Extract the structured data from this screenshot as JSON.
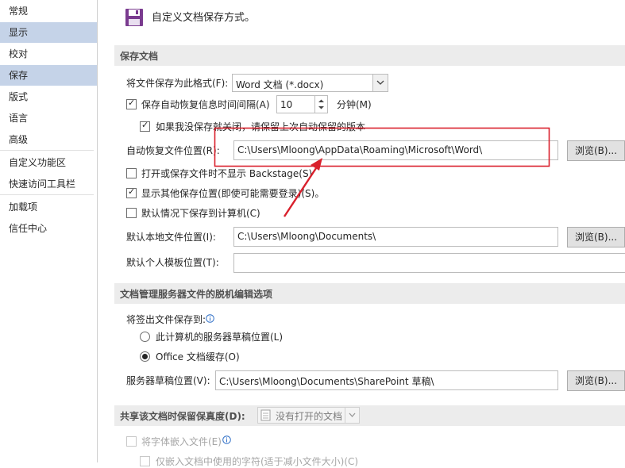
{
  "sidebar": {
    "items": [
      {
        "label": "常规"
      },
      {
        "label": "显示"
      },
      {
        "label": "校对"
      },
      {
        "label": "保存"
      },
      {
        "label": "版式"
      },
      {
        "label": "语言"
      },
      {
        "label": "高级"
      },
      {
        "label": "自定义功能区"
      },
      {
        "label": "快速访问工具栏"
      },
      {
        "label": "加载项"
      },
      {
        "label": "信任中心"
      }
    ]
  },
  "header": {
    "title": "自定义文档保存方式。",
    "icon": "save-icon"
  },
  "save_docs": {
    "section_title": "保存文档",
    "format_label": "将文件保存为此格式(F):",
    "format_value": "Word 文档 (*.docx)",
    "autorecover_label": "保存自动恢复信息时间间隔(A)",
    "autorecover_minutes": "10",
    "minutes_label": "分钟(M)",
    "keep_last_label": "如果我没保存就关闭，请保留上次自动保留的版本",
    "autorecover_location_label": "自动恢复文件位置(R):",
    "autorecover_location_value": "C:\\Users\\Mloong\\AppData\\Roaming\\Microsoft\\Word\\",
    "browse_label": "浏览(B)...",
    "no_backstage_label": "打开或保存文件时不显示 Backstage(S)",
    "show_other_label": "显示其他保存位置(即使可能需要登录)(S)。",
    "save_to_computer_label": "默认情况下保存到计算机(C)",
    "local_location_label": "默认本地文件位置(I):",
    "local_location_value": "C:\\Users\\Mloong\\Documents\\",
    "template_location_label": "默认个人模板位置(T):",
    "template_location_value": ""
  },
  "offline": {
    "section_title": "文档管理服务器文件的脱机编辑选项",
    "checkout_label": "将签出文件保存到:",
    "option_server": "此计算机的服务器草稿位置(L)",
    "option_office": "Office 文档缓存(O)",
    "drafts_label": "服务器草稿位置(V):",
    "drafts_value": "C:\\Users\\Mloong\\Documents\\SharePoint 草稿\\",
    "browse_label": "浏览(B)..."
  },
  "fidelity": {
    "section_title": "共享该文档时保留保真度(D):",
    "doc_select": "没有打开的文档",
    "embed_fonts_label": "将字体嵌入文件(E)",
    "embed_used_label": "仅嵌入文档中使用的字符(适于减小文件大小)(C)"
  },
  "colors": {
    "selected_nav": "#c5d3e8",
    "annotation": "#d9202c"
  }
}
